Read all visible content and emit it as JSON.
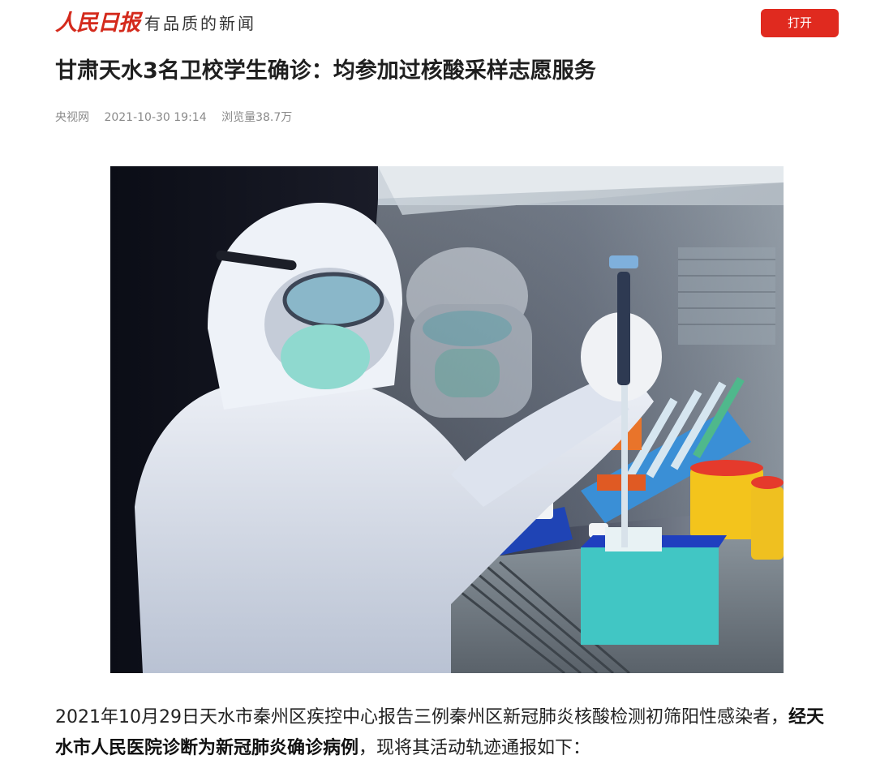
{
  "header": {
    "logo_text": "人民日报",
    "slogan": "有品质的新闻",
    "open_button": "打开"
  },
  "article": {
    "title": "甘肃天水3名卫校学生确诊：均参加过核酸采样志愿服务",
    "source": "央视网",
    "datetime": "2021-10-30 19:14",
    "views": "浏览量38.7万",
    "image_icon": "lab-worker-photo",
    "paragraph": {
      "part1": "2021年10月29日天水市秦州区疾控中心报告三例秦州区新冠肺炎核酸检测初筛阳性感染者，",
      "bold": "经天水市人民医院诊断为新冠肺炎确诊病例",
      "part2": "，现将其活动轨迹通报如下："
    }
  },
  "colors": {
    "brand_red": "#e02a1f",
    "meta_gray": "#8a8a8a"
  }
}
